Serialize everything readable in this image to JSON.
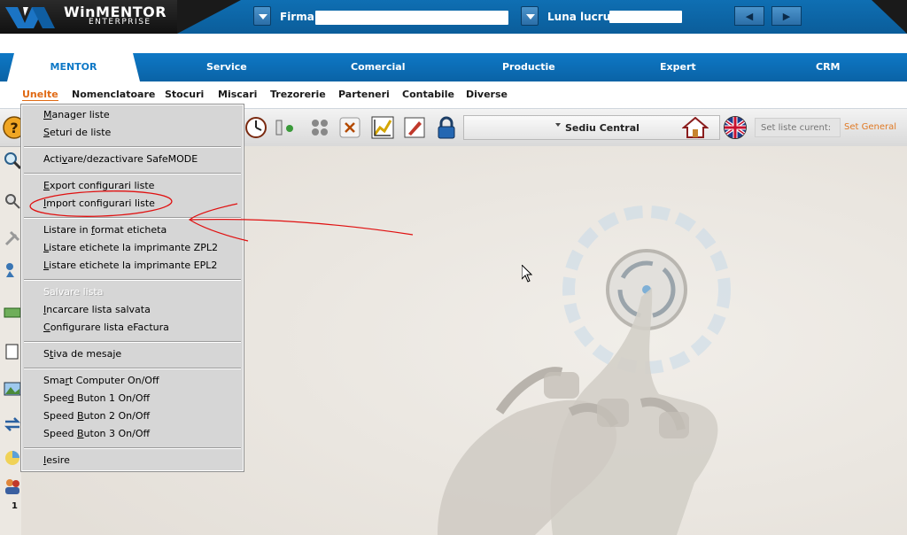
{
  "header": {
    "logo_title": "WinMENTOR",
    "logo_subtitle": "ENTERPRISE",
    "firma_label": "Firma:",
    "luna_label": "Luna lucru:"
  },
  "tabs": [
    {
      "label": "MENTOR",
      "active": true
    },
    {
      "label": "Service"
    },
    {
      "label": "Comercial"
    },
    {
      "label": "Productie"
    },
    {
      "label": "Expert"
    },
    {
      "label": "CRM"
    }
  ],
  "menubar": {
    "items": [
      "Unelte",
      "Nomenclatoare",
      "Stocuri",
      "Miscari",
      "Trezorerie",
      "Parteneri",
      "Contabile",
      "Diverse"
    ],
    "active": "Unelte"
  },
  "toolbar": {
    "branch": "Sediu Central",
    "set_placeholder": "Set liste curent:",
    "set_link": "Set General"
  },
  "dropdown": {
    "items": [
      {
        "label": "Manager liste",
        "mnemonic": "M"
      },
      {
        "label": "Seturi de liste",
        "mnemonic": "S"
      },
      {
        "label": "Activare/dezactivare  SafeMODE",
        "mnemonic": "v"
      },
      {
        "label": "Export configurari liste",
        "mnemonic": "E"
      },
      {
        "label": "Import configurari liste",
        "mnemonic": "I"
      },
      {
        "label": "Listare in format eticheta",
        "mnemonic": "f"
      },
      {
        "label": "Listare etichete la imprimante ZPL2",
        "mnemonic": "L"
      },
      {
        "label": "Listare etichete la imprimante EPL2",
        "mnemonic": "L"
      },
      {
        "label": "Salvare lista",
        "disabled": true
      },
      {
        "label": "Incarcare lista salvata",
        "mnemonic": "I"
      },
      {
        "label": "Configurare lista eFactura",
        "mnemonic": "C"
      },
      {
        "label": "Stiva de mesaje",
        "mnemonic": "t"
      },
      {
        "label": "Smart Computer On/Off",
        "mnemonic": "r"
      },
      {
        "label": "Speed Buton 1  On/Off",
        "mnemonic": "d"
      },
      {
        "label": "Speed Buton 2  On/Off",
        "mnemonic": "B"
      },
      {
        "label": "Speed Buton 3  On/Off",
        "mnemonic": "B"
      },
      {
        "label": "Iesire",
        "mnemonic": "I"
      }
    ]
  },
  "leftrail": {
    "count": "1"
  },
  "colors": {
    "brand_blue": "#0e78c6",
    "accent_orange": "#e06a15",
    "annotation_red": "#e01010"
  },
  "icons": [
    "help-icon",
    "clock-icon",
    "toggle-icon",
    "grid-icon",
    "close-icon",
    "chart-icon",
    "pencil-icon",
    "lock-icon",
    "home-icon",
    "uk-flag-icon"
  ]
}
